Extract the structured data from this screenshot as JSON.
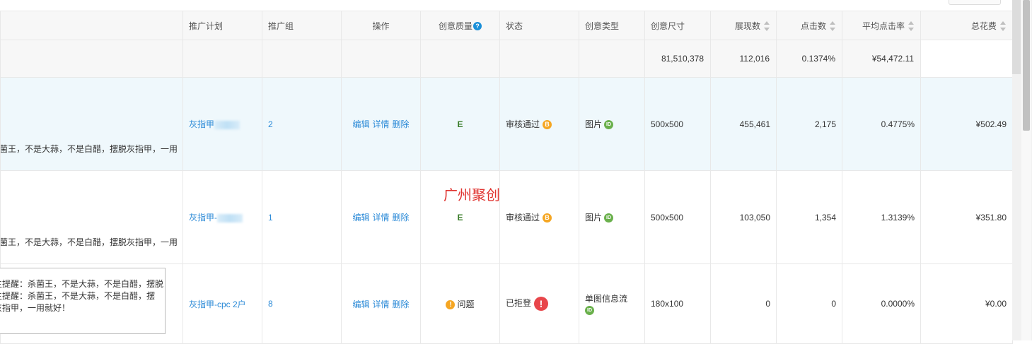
{
  "columns": {
    "plan": "推广计划",
    "group": "推广组",
    "ops": "操作",
    "quality": "创意质量",
    "status": "状态",
    "type": "创意类型",
    "size": "创意尺寸",
    "impressions": "展现数",
    "clicks": "点击数",
    "ctr": "平均点击率",
    "cost": "总花费"
  },
  "summary": {
    "impressions": "81,510,378",
    "clicks": "112,016",
    "ctr": "0.1374%",
    "cost": "¥54,472.11"
  },
  "ops": {
    "edit": "编辑",
    "detail": "详情",
    "delete": "删除"
  },
  "rows": [
    {
      "creative": "菌王，不是大蒜，不是白醋，摆脱灰指甲，一用",
      "plan": "灰指甲",
      "group": "2",
      "quality": "E",
      "status": "审核通过",
      "status_badge": "B",
      "type": "图片",
      "type_badge": "ID",
      "size": "500x500",
      "impressions": "455,461",
      "clicks": "2,175",
      "ctr": "0.4775%",
      "cost": "¥502.49"
    },
    {
      "creative": "菌王，不是大蒜，不是白醋，摆脱灰指甲，一用",
      "plan": "灰指甲-",
      "group": "1",
      "quality": "E",
      "status": "审核通过",
      "status_badge": "B",
      "type": "图片",
      "type_badge": "ID",
      "size": "500x500",
      "impressions": "103,050",
      "clicks": "1,354",
      "ctr": "1.3139%",
      "cost": "¥351.80"
    },
    {
      "plan": "灰指甲-cpc 2户",
      "group": "8",
      "quality": "问题",
      "status": "已拒登",
      "type": "单图信息流",
      "type_badge": "ID",
      "size": "180x100",
      "impressions": "0",
      "clicks": "0",
      "ctr": "0.0000%",
      "cost": "¥0.00"
    }
  ],
  "tooltip": {
    "line1": "主提醒：杀菌王，不是大蒜，不是白醋，摆脱",
    "line2": "主提醒：杀菌王，不是大蒜，不是白醋，摆",
    "line3": "灰指甲，一用就好！"
  },
  "watermark": "广州聚创",
  "colors": {
    "link": "#2b8ad7",
    "highlight_row": "#eff8fc",
    "watermark": "#e0332f",
    "error": "#e8464b",
    "badge": "#f5a623"
  }
}
